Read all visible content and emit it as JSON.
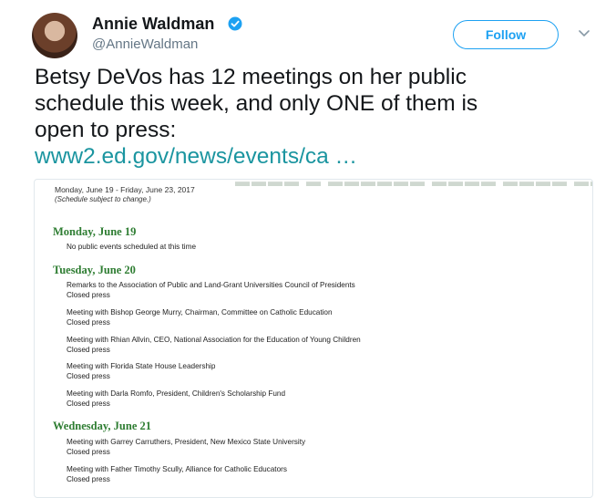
{
  "author": {
    "name": "Annie Waldman",
    "handle": "@AnnieWaldman",
    "verified_icon": "verified-badge-icon",
    "avatar_icon": "profile-photo"
  },
  "actions": {
    "follow_label": "Follow",
    "menu_icon": "chevron-down-icon"
  },
  "tweet": {
    "line1": "Betsy DeVos has 12 meetings on her public",
    "line2": "schedule this week, and only ONE of them is",
    "line3": "open to press:",
    "link": "www2.ed.gov/news/events/ca …"
  },
  "colors": {
    "accent": "#1da1f2",
    "link": "#1b95a0",
    "day_heading": "#2e7d32"
  },
  "schedule": {
    "date_range": "Monday, June 19 - Friday, June 23, 2017",
    "note": "(Schedule subject to change.)",
    "days": [
      {
        "heading": "Monday, June 19",
        "none_text": "No public events scheduled at this time",
        "events": []
      },
      {
        "heading": "Tuesday, June 20",
        "events": [
          {
            "title": "Remarks to the Association of Public and Land-Grant Universities Council of Presidents",
            "status": "Closed press"
          },
          {
            "title": "Meeting with Bishop George Murry, Chairman, Committee on Catholic Education",
            "status": "Closed press"
          },
          {
            "title": "Meeting with Rhian Allvin, CEO, National Association for the Education of Young Children",
            "status": "Closed press"
          },
          {
            "title": "Meeting with Florida State House Leadership",
            "status": "Closed press"
          },
          {
            "title": "Meeting with Darla Romfo, President, Children's Scholarship Fund",
            "status": "Closed press"
          }
        ]
      },
      {
        "heading": "Wednesday, June 21",
        "events": [
          {
            "title": "Meeting with Garrey Carruthers, President, New Mexico State University",
            "status": "Closed press"
          },
          {
            "title": "Meeting with Father Timothy Scully, Alliance for Catholic Educators",
            "status": "Closed press"
          }
        ]
      }
    ]
  }
}
